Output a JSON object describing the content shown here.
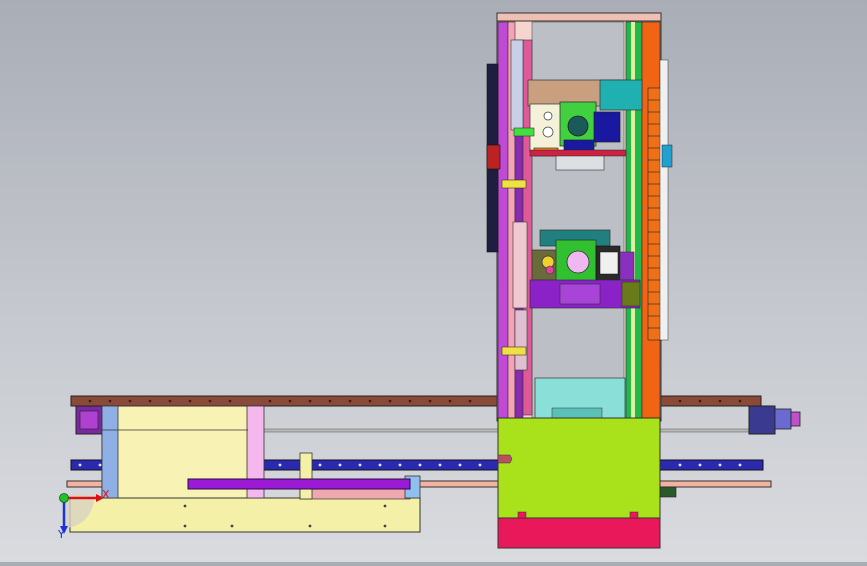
{
  "viewport": {
    "background_top": "#a9adb6",
    "background_bottom": "#d9dbdf"
  },
  "triad": {
    "x_label": "X",
    "y_label": "Y",
    "x_color": "#dd1111",
    "y_color": "#1a33d6",
    "origin_color": "#22c02a"
  },
  "colors": {
    "frame_tower": "#f5d6cf",
    "gantry_pink": "#f4b2a2",
    "rail_brown": "#8a4a3a",
    "rail_blue": "#2a2ab0",
    "base_plate": "#f5f0a8",
    "carriage_green": "#a9e21a",
    "carriage_red": "#e8185a",
    "column_orange": "#f06414",
    "column_green": "#22b84a",
    "column_purple": "#c04ad6",
    "head_teal": "#1e9aa8",
    "head_green": "#40d040",
    "head_purple": "#8a22c8",
    "cylinder_purple": "#9a1ad6",
    "cyan_block": "#8ae0d8"
  }
}
